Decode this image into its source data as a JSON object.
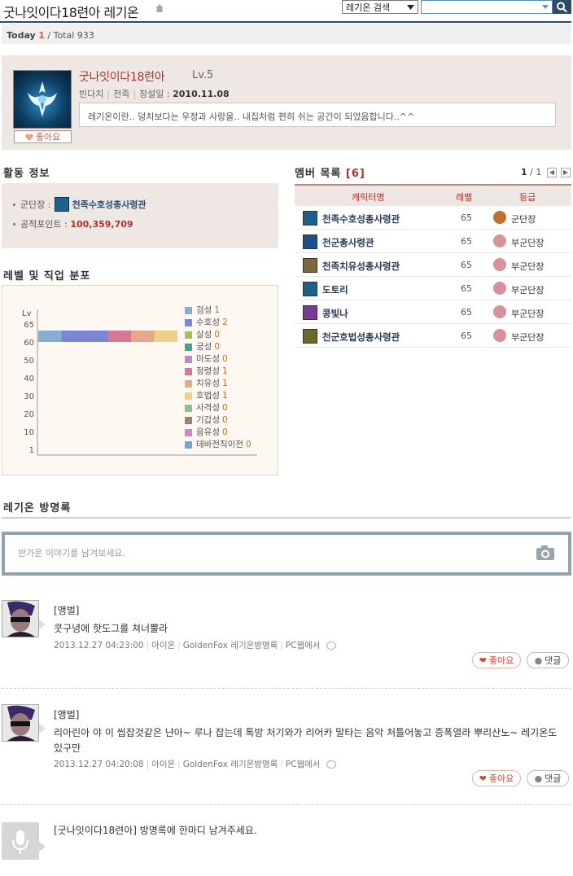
{
  "header": {
    "title": "굿나잇이다18련아 레기온",
    "search_select": "레기온 검색",
    "search_placeholder": ""
  },
  "today": {
    "label": "Today",
    "today_count": "1",
    "total_label": "/ Total 933"
  },
  "profile": {
    "name": "굿나잇이다18련아",
    "level": "Lv.5",
    "server": "빈다치",
    "race": "천족",
    "founded_label": "창설일 :",
    "founded": "2010.11.08",
    "intro": "레기온이란.. 덩치보다는 우정과 사랑을.. 내집처럼 편히 쉬는 공간이 되었음합니다..^^",
    "like_label": "좋아요"
  },
  "activity": {
    "title": "활동 정보",
    "leader_label": "군단장 :",
    "leader_name": "천족수호성총사령관",
    "points_label": "공적포인트 :",
    "points": "100,359,709"
  },
  "distribution": {
    "title": "레벨 및 직업 분포"
  },
  "chart_data": {
    "type": "bar",
    "orientation": "horizontal-stacked",
    "y_axis_title": "Lv",
    "y_ticks": [
      "65",
      "60",
      "50",
      "40",
      "30",
      "20",
      "10",
      "1"
    ],
    "categories": [
      "65"
    ],
    "series": [
      {
        "name": "검성",
        "values": [
          1
        ],
        "color": "#86aed0"
      },
      {
        "name": "수호성",
        "values": [
          2
        ],
        "color": "#7b86d6"
      },
      {
        "name": "살성",
        "values": [
          0
        ],
        "color": "#a6c24a"
      },
      {
        "name": "궁성",
        "values": [
          0
        ],
        "color": "#4aa088"
      },
      {
        "name": "마도성",
        "values": [
          0
        ],
        "color": "#c486c8"
      },
      {
        "name": "정령성",
        "values": [
          1
        ],
        "color": "#d87898"
      },
      {
        "name": "치유성",
        "values": [
          1
        ],
        "color": "#e6a888"
      },
      {
        "name": "호법성",
        "values": [
          1
        ],
        "color": "#eed084"
      },
      {
        "name": "사격성",
        "values": [
          0
        ],
        "color": "#8ac48a"
      },
      {
        "name": "기갑성",
        "values": [
          0
        ],
        "color": "#a08070"
      },
      {
        "name": "음유성",
        "values": [
          0
        ],
        "color": "#d880c8"
      },
      {
        "name": "데바전직이전",
        "values": [
          0
        ],
        "color": "#7aa2d0"
      }
    ]
  },
  "members": {
    "title": "멤버 목록",
    "count": "[6]",
    "page_current": "1",
    "page_total": "/ 1",
    "columns": {
      "name": "캐릭터명",
      "level": "레벨",
      "grade": "등급"
    },
    "rows": [
      {
        "name": "천족수호성총사령관",
        "level": "65",
        "grade": "군단장",
        "class_color": "#1e5f8c",
        "grade_color": "#c0702a"
      },
      {
        "name": "천군총사령관",
        "level": "65",
        "grade": "부군단장",
        "class_color": "#1e4f8c",
        "grade_color": "#d8909a"
      },
      {
        "name": "천족치유성총사령관",
        "level": "65",
        "grade": "부군단장",
        "class_color": "#7a6a3a",
        "grade_color": "#d8909a"
      },
      {
        "name": "도토리",
        "level": "65",
        "grade": "부군단장",
        "class_color": "#1e5f8c",
        "grade_color": "#d8909a"
      },
      {
        "name": "콩빛나",
        "level": "65",
        "grade": "부군단장",
        "class_color": "#7a3a9a",
        "grade_color": "#d8909a"
      },
      {
        "name": "천군호법성총사령관",
        "level": "65",
        "grade": "부군단장",
        "class_color": "#6a6a2a",
        "grade_color": "#d8909a"
      }
    ]
  },
  "guestbook": {
    "title": "레기온 방명록",
    "input_placeholder": "반가운 이야기를 남겨보세요.",
    "posts": [
      {
        "author": "[앵벌]",
        "text": "콧구녕에 핫도그를 쳐너뿔라",
        "date": "2013.12.27 04:23:00",
        "server": "아이온",
        "source": "GoldenFox 레기온방명록",
        "device": "PC웹에서",
        "like": "좋아요",
        "comment": "댓글"
      },
      {
        "author": "[앵벌]",
        "text": "리아린아 야 이 씹잡것같은 냔아~ 루나 잡는데 톡방 처기와가 리어카 말타는 음악 처틀어놓고 증폭열라 뿌리산노~ 레기온도 있구만",
        "date": "2013.12.27 04:20:08",
        "server": "아이온",
        "source": "GoldenFox 레기온방명록",
        "device": "PC웹에서",
        "like": "좋아요",
        "comment": "댓글"
      }
    ],
    "prompt": "[굿나잇이다18련아] 방명록에 한마디 남겨주세요."
  }
}
